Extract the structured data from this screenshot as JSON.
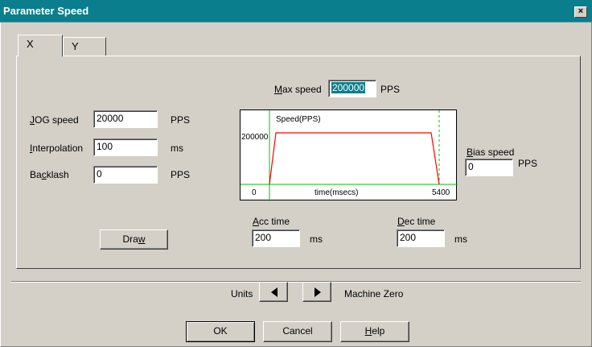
{
  "window": {
    "title": "Parameter Speed",
    "close_label": "×"
  },
  "tabs": [
    {
      "label": "X"
    },
    {
      "label": "Y"
    }
  ],
  "max_speed": {
    "label_u": "M",
    "label_rest": "ax speed",
    "value": "200000",
    "unit": "PPS"
  },
  "jog_speed": {
    "label_u": "J",
    "label_rest": "OG speed",
    "value": "20000",
    "unit": "PPS"
  },
  "interpolation": {
    "label_u": "I",
    "label_rest": "nterpolation",
    "value": "100",
    "unit": "ms"
  },
  "backlash": {
    "label_pre": "Ba",
    "label_u": "c",
    "label_rest": "klash",
    "value": "0",
    "unit": "PPS"
  },
  "bias_speed": {
    "label_u": "B",
    "label_rest": "ias speed",
    "value": "0",
    "unit": "PPS"
  },
  "acc_time": {
    "label_u": "A",
    "label_rest": "cc time",
    "value": "200",
    "unit": "ms"
  },
  "dec_time": {
    "label_u": "D",
    "label_rest": "ec time",
    "value": "200",
    "unit": "ms"
  },
  "draw_button": {
    "label_pre": "Dra",
    "label_u": "w"
  },
  "graph": {
    "title": "Speed(PPS)",
    "y_label": "200000",
    "x_start": "0",
    "x_end": "5400",
    "x_label": "time(msecs)",
    "line_color": "#ff0000",
    "axis_color": "#00c000"
  },
  "units": {
    "label": "Units",
    "right_label": "Machine Zero"
  },
  "buttons": {
    "ok": "OK",
    "cancel": "Cancel",
    "help_u": "H",
    "help_rest": "elp"
  },
  "colors": {
    "titlebar": "#0a7e8c",
    "dialog": "#d4d0c8"
  }
}
